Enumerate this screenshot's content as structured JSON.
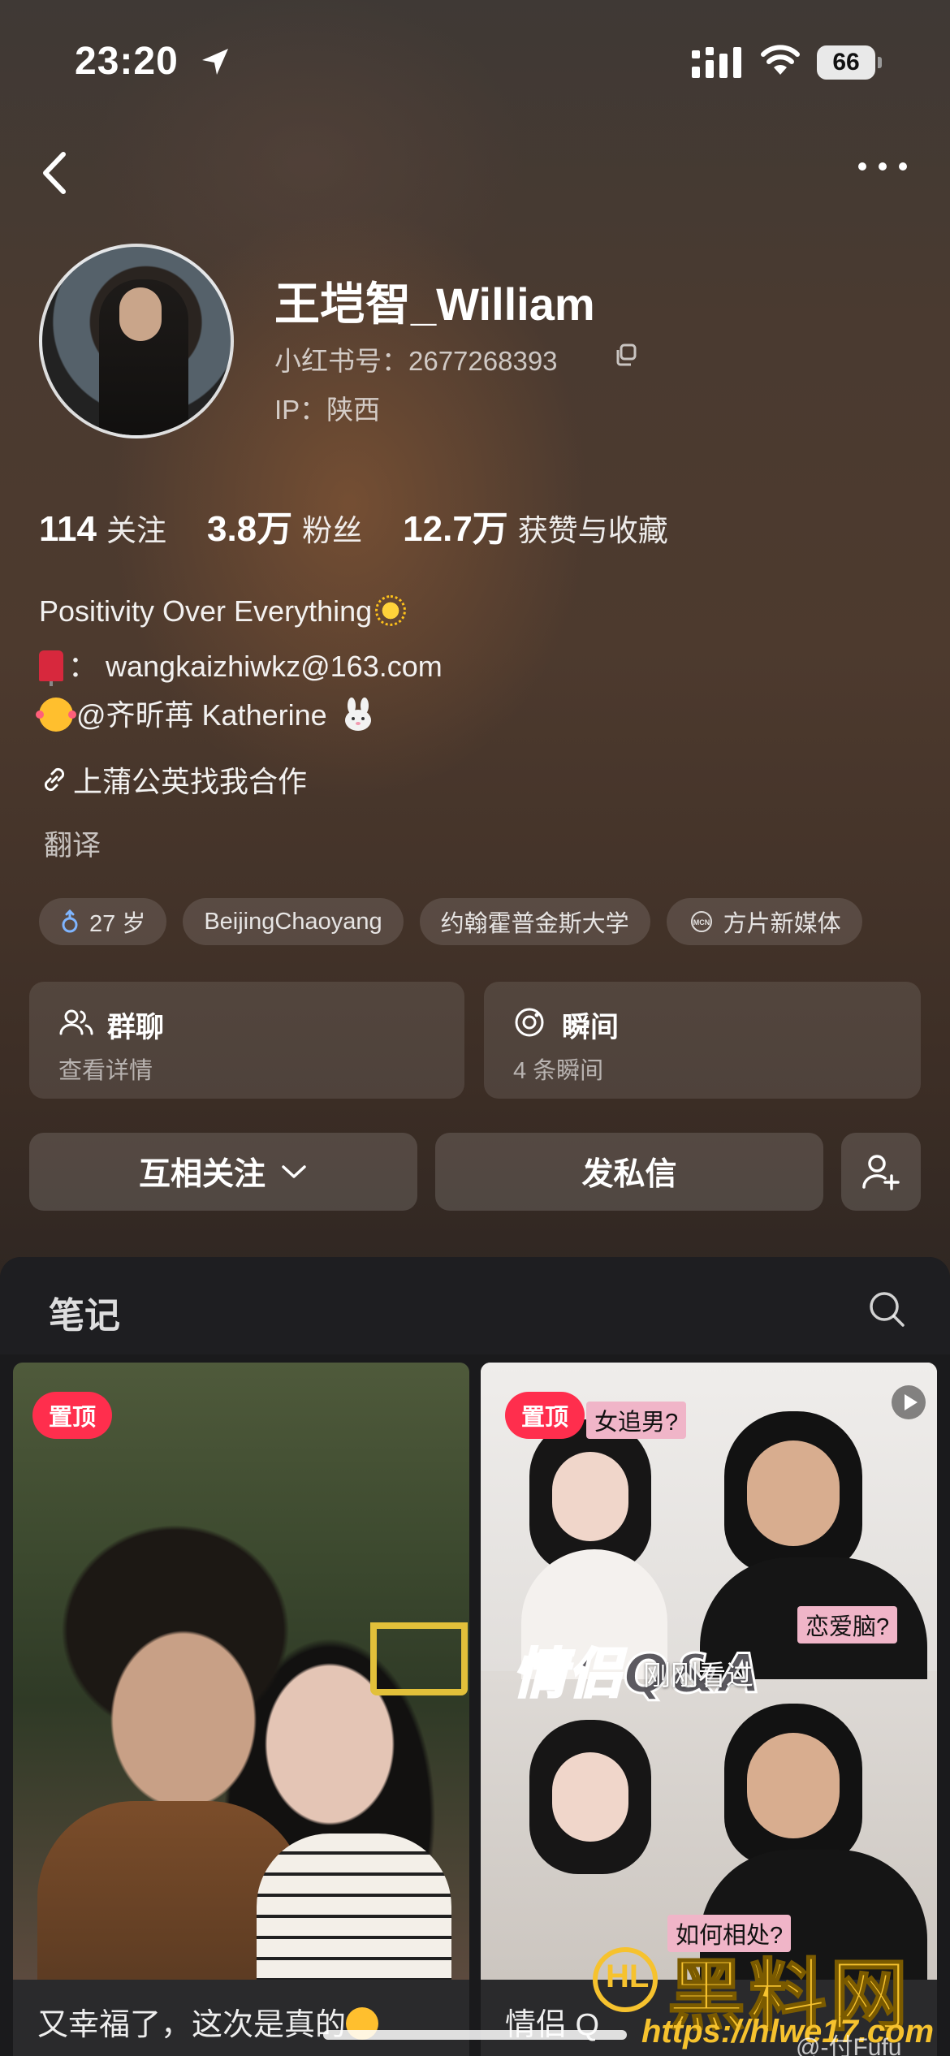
{
  "status_bar": {
    "time": "23:20",
    "battery": "66"
  },
  "profile": {
    "name": "王垲智_William",
    "red_id": "小红书号：2677268393",
    "ip": "IP：陕西",
    "stats": [
      {
        "value": "114",
        "label": "关注"
      },
      {
        "value": "3.8万",
        "label": "粉丝"
      },
      {
        "value": "12.7万",
        "label": "获赞与收藏"
      }
    ],
    "bio_line1": "Positivity Over Everything",
    "bio_line2": "： wangkaizhiwkz@163.com",
    "bio_line3": "@齐昕苒 Katherine",
    "link_text": "上蒲公英找我合作",
    "translate": "翻译",
    "tags": [
      "27 岁",
      "BeijingChaoyang",
      "约翰霍普金斯大学",
      "方片新媒体"
    ]
  },
  "cards": {
    "group": {
      "title": "群聊",
      "sub": "查看详情"
    },
    "moment": {
      "title": "瞬间",
      "sub": "4 条瞬间"
    }
  },
  "actions": {
    "follow": "互相关注",
    "message": "发私信"
  },
  "notes": {
    "tab": "笔记",
    "posts": [
      {
        "pin": "置顶",
        "caption": "又幸福了，这次是真的"
      },
      {
        "pin": "置顶",
        "caption": "情侣 Q",
        "overlay_seen": "刚刚看过",
        "banner": "情侣Q&A",
        "labels": [
          "女追男?",
          "恋爱脑?",
          "如何相处?"
        ]
      }
    ]
  },
  "watermark": {
    "logo": "HL",
    "main": "黑料网",
    "url": "https://hlwe17.com",
    "user": "@-付Fufu"
  },
  "colors": {
    "pin": "#ff2e4d",
    "watermark": "#f6c22e"
  }
}
